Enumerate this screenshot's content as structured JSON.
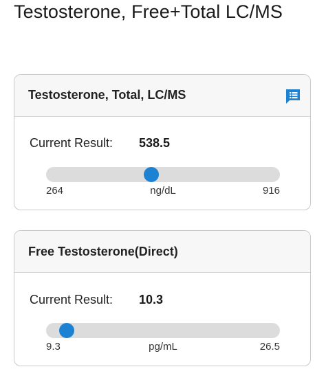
{
  "page": {
    "title": "Testosterone, Free+Total LC/MS"
  },
  "cards": [
    {
      "title": "Testosterone, Total, LC/MS",
      "has_note_icon": true,
      "result_label": "Current Result:",
      "result_value": "538.5",
      "range_min": "264",
      "range_max": "916",
      "unit": "ng/dL",
      "marker_fraction": 0.45
    },
    {
      "title": "Free Testosterone(Direct)",
      "has_note_icon": false,
      "result_label": "Current Result:",
      "result_value": "10.3",
      "range_min": "9.3",
      "range_max": "26.5",
      "unit": "pg/mL",
      "marker_fraction": 0.088
    }
  ],
  "colors": {
    "accent": "#1e82d2",
    "track": "#dcdcdc",
    "card_header_bg": "#f7f7f7",
    "card_border": "#c9c9c9"
  },
  "icons": {
    "note": "notes-icon"
  }
}
